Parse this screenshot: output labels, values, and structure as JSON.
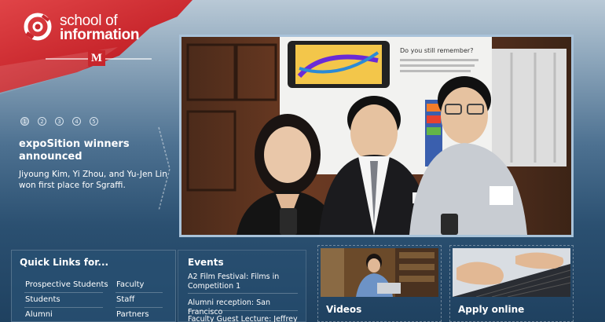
{
  "logo": {
    "line1": "school of",
    "line2": "information",
    "badge": "M"
  },
  "slider": {
    "dots": [
      "1",
      "2",
      "3",
      "4",
      "5"
    ],
    "active": 1,
    "headline": "expoSition winners announced",
    "subtext": "Jiyoung Kim, Yi Zhou, and Yu-Jen Lin won first place for Sgraffi."
  },
  "photo": {
    "poster_heading": "Do you still remember?"
  },
  "quick_links": {
    "title": "Quick Links for...",
    "left": [
      "Prospective Students",
      "Students",
      "Alumni"
    ],
    "right": [
      "Faculty",
      "Staff",
      "Partners"
    ]
  },
  "events": {
    "title": "Events",
    "items": [
      "A2 Film Festival: Films in Competition 1",
      "Alumni reception: San Francisco",
      "Faculty Guest Lecture: Jeffrey"
    ]
  },
  "tiles": {
    "videos": "Videos",
    "apply": "Apply online"
  }
}
